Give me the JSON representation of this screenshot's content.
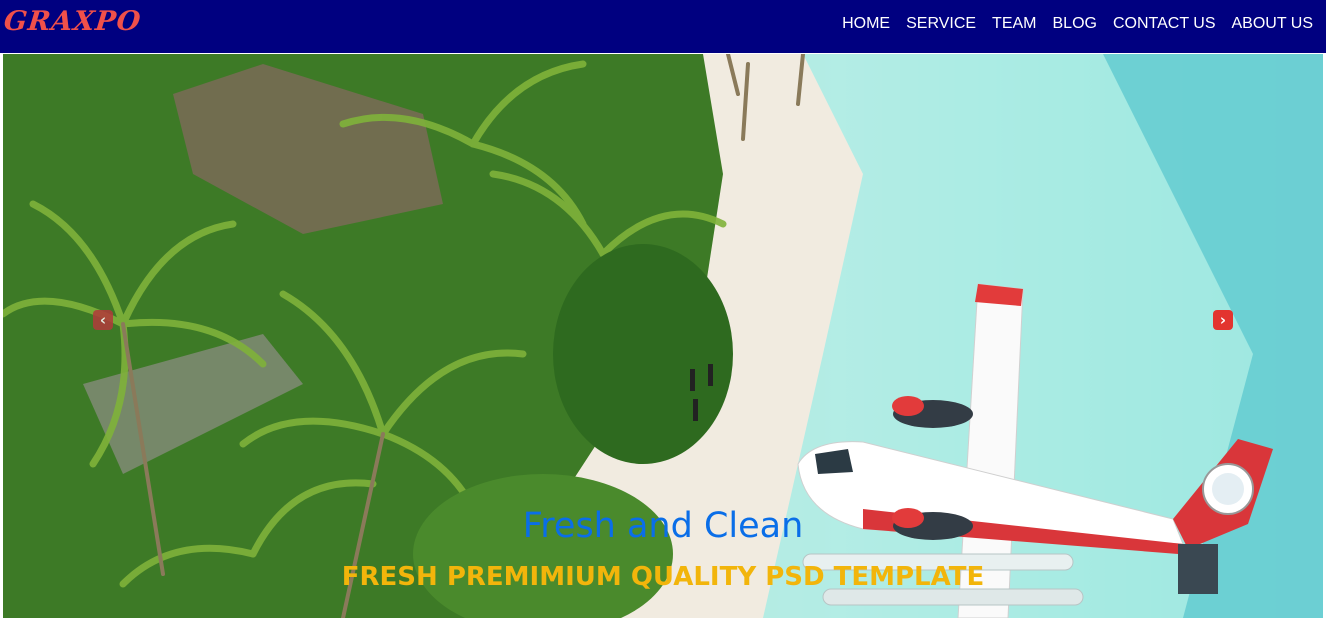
{
  "brand": {
    "logo_text": "GRAXPO",
    "logo_color": "#f0504a"
  },
  "colors": {
    "navbar_bg": "#000080",
    "title_color": "#0a6ee8",
    "subtitle_color": "#f2b50b",
    "arrow_color": "#e3342f"
  },
  "nav": {
    "items": [
      {
        "label": "HOME"
      },
      {
        "label": "SERVICE"
      },
      {
        "label": "TEAM"
      },
      {
        "label": "BLOG"
      },
      {
        "label": "CONTACT US"
      },
      {
        "label": "ABOUT US"
      }
    ]
  },
  "hero": {
    "title": "Fresh and Clean",
    "subtitle": "FRESH PREMIMIUM QUALITY PSD TEMPLATE",
    "prev_icon": "chevron-left-icon",
    "next_icon": "chevron-right-icon",
    "prev_glyph": "‹",
    "next_glyph": "›",
    "image_subject": "tropical beach with palm trees and seaplane"
  }
}
